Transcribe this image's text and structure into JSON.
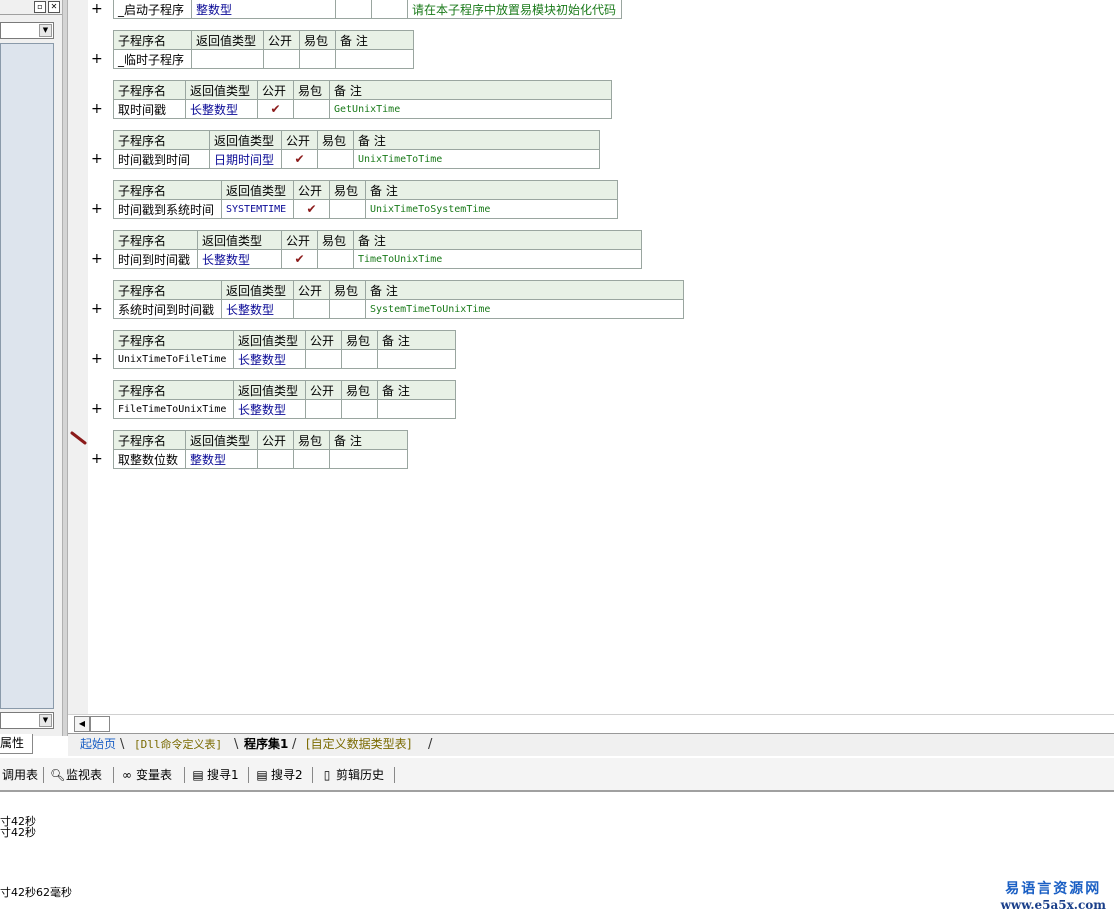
{
  "left_panel": {
    "title_buttons": [
      "▫",
      "✕"
    ],
    "tab_label": "属性"
  },
  "tabs": [
    {
      "label": "起始页",
      "color": "#1a5fc4"
    },
    {
      "label": "[Dll命令定义表]",
      "color": "#7a6a00"
    },
    {
      "label": "程序集1",
      "color": "#000000"
    },
    {
      "label": "[自定义数据类型表]",
      "color": "#7a6a00"
    }
  ],
  "toolbar": [
    {
      "label": "调用表",
      "icon": "call-table-icon"
    },
    {
      "label": "监视表",
      "icon": "magnifier-icon"
    },
    {
      "label": "变量表",
      "icon": "variables-icon"
    },
    {
      "label": "搜寻1",
      "icon": "search-list-icon"
    },
    {
      "label": "搜寻2",
      "icon": "search-list-icon"
    },
    {
      "label": "剪辑历史",
      "icon": "clipboard-icon"
    }
  ],
  "output_lines": [
    "寸42秒",
    "寸42秒",
    "寸42秒62毫秒"
  ],
  "watermark": {
    "line1": "易语言资源网",
    "line2": "www.e5a5x.com"
  },
  "headers": {
    "name": "子程序名",
    "ret": "返回值类型",
    "public": "公开",
    "easy": "易包",
    "note": "备 注"
  },
  "subroutines": [
    {
      "name": "_启动子程序",
      "ret": "整数型",
      "public": "",
      "easy": "",
      "note": "请在本子程序中放置易模块初始化代码",
      "has_header": false
    },
    {
      "name": "_临时子程序",
      "ret": "",
      "public": "",
      "easy": "",
      "note": "",
      "has_header": true
    },
    {
      "name": "取时间戳",
      "ret": "长整数型",
      "public": "✔",
      "easy": "",
      "note": "GetUnixTime",
      "has_header": true
    },
    {
      "name": "时间戳到时间",
      "ret": "日期时间型",
      "public": "✔",
      "easy": "",
      "note": "UnixTimeToTime",
      "has_header": true
    },
    {
      "name": "时间戳到系统时间",
      "ret": "SYSTEMTIME",
      "public": "✔",
      "easy": "",
      "note": "UnixTimeToSystemTime",
      "has_header": true
    },
    {
      "name": "时间到时间戳",
      "ret": "长整数型",
      "public": "✔",
      "easy": "",
      "note": "TimeToUnixTime",
      "has_header": true
    },
    {
      "name": "系统时间到时间戳",
      "ret": "长整数型",
      "public": "",
      "easy": "",
      "note": "SystemTimeToUnixTime",
      "has_header": true
    },
    {
      "name": "UnixTimeToFileTime",
      "ret": "长整数型",
      "public": "",
      "easy": "",
      "note": "",
      "has_header": true
    },
    {
      "name": "FileTimeToUnixTime",
      "ret": "长整数型",
      "public": "",
      "easy": "",
      "note": "",
      "has_header": true
    },
    {
      "name": "取整数位数",
      "ret": "整数型",
      "public": "",
      "easy": "",
      "note": "",
      "has_header": true
    }
  ],
  "plus_sign": "+"
}
